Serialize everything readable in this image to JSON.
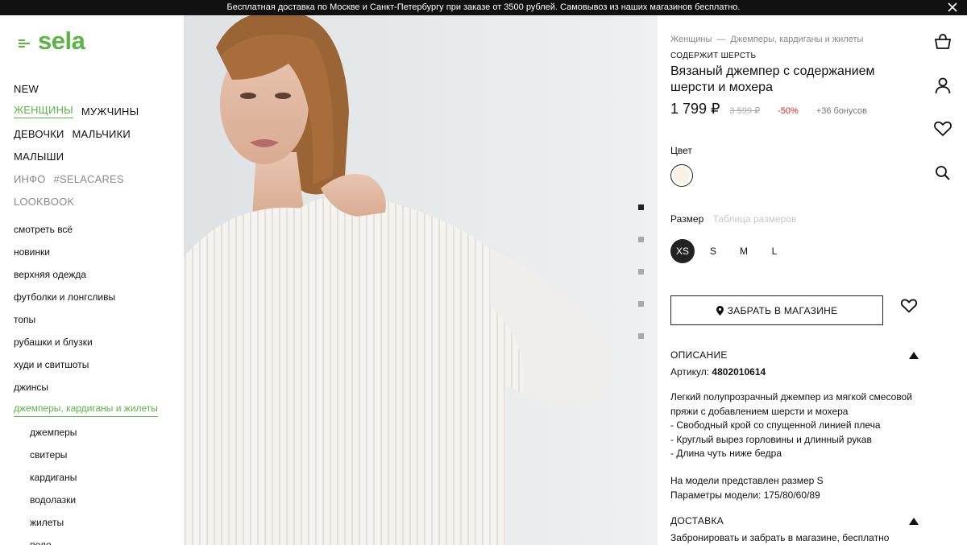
{
  "topbar": {
    "text": "Бесплатная доставка по Москве и Санкт-Петербургу при заказе от 3500 рублей. Самовывоз из наших магазинов бесплатно."
  },
  "logo": {
    "text": "sela",
    "color": "#5bb544"
  },
  "main_nav": {
    "rows": [
      [
        {
          "label": "NEW"
        }
      ],
      [
        {
          "label": "ЖЕНЩИНЫ",
          "active": true
        },
        {
          "label": "МУЖЧИНЫ"
        }
      ],
      [
        {
          "label": "ДЕВОЧКИ"
        },
        {
          "label": "МАЛЬЧИКИ"
        }
      ],
      [
        {
          "label": "МАЛЫШИ"
        }
      ],
      [
        {
          "label": "ИНФО",
          "muted": true
        },
        {
          "label": "#SELACARES",
          "muted": true
        }
      ],
      [
        {
          "label": "LOOKBOOK",
          "muted": true
        }
      ]
    ]
  },
  "category_nav": {
    "items": [
      {
        "label": "смотреть всё"
      },
      {
        "label": "новинки"
      },
      {
        "label": "верхняя одежда"
      },
      {
        "label": "футболки и лонгсливы"
      },
      {
        "label": "топы"
      },
      {
        "label": "рубашки и блузки"
      },
      {
        "label": "худи и свитшоты"
      },
      {
        "label": "джинсы"
      },
      {
        "label": "джемперы, кардиганы и жилеты",
        "active": true
      },
      {
        "label": "джемперы",
        "sub": true
      },
      {
        "label": "свитеры",
        "sub": true
      },
      {
        "label": "кардиганы",
        "sub": true
      },
      {
        "label": "водолазки",
        "sub": true
      },
      {
        "label": "жилеты",
        "sub": true
      },
      {
        "label": "поло",
        "sub": true
      }
    ]
  },
  "gallery": {
    "slide_count": 5,
    "active_index": 0
  },
  "product": {
    "breadcrumbs": [
      "Женщины",
      "Джемперы, кардиганы и жилеты"
    ],
    "breadcrumb_separator": "—",
    "badge": "СОДЕРЖИТ ШЕРСТЬ",
    "title": "Вязаный джемпер с содержанием шерсти и мохера",
    "price": "1 799 ₽",
    "old_price": "3 599 ₽",
    "discount": "-50%",
    "bonus": "+36  бонусов",
    "color_label": "Цвет",
    "color_swatch": "#f8f1e4",
    "size_label": "Размер",
    "size_table_link": "Таблица размеров",
    "sizes": [
      {
        "label": "XS",
        "selected": true
      },
      {
        "label": "S"
      },
      {
        "label": "M"
      },
      {
        "label": "L"
      }
    ],
    "pickup_button": "ЗАБРАТЬ В МАГАЗИНЕ",
    "description_title": "ОПИСАНИЕ",
    "article_label": "Артикул:",
    "article_value": "4802010614",
    "description_lines": [
      "Легкий полупрозрачный джемпер из мягкой смесовой пряжи с добавлением шерсти и мохера",
      "- Свободный крой со спущенной линией плеча",
      "- Круглый вырез горловины и длинный рукав",
      "- Длина чуть ниже бедра"
    ],
    "model_lines": [
      "На модели представлен размер S",
      "Параметры модели: 175/80/60/89"
    ],
    "delivery_title": "ДОСТАВКА",
    "delivery_text": "Забронировать и забрать в магазине, бесплатно"
  },
  "right_icons": [
    "basket-icon",
    "user-icon",
    "heart-icon",
    "search-icon"
  ],
  "colors": {
    "accent": "#5bb544",
    "sale": "#e3261c",
    "topbar_bg": "#111111"
  }
}
